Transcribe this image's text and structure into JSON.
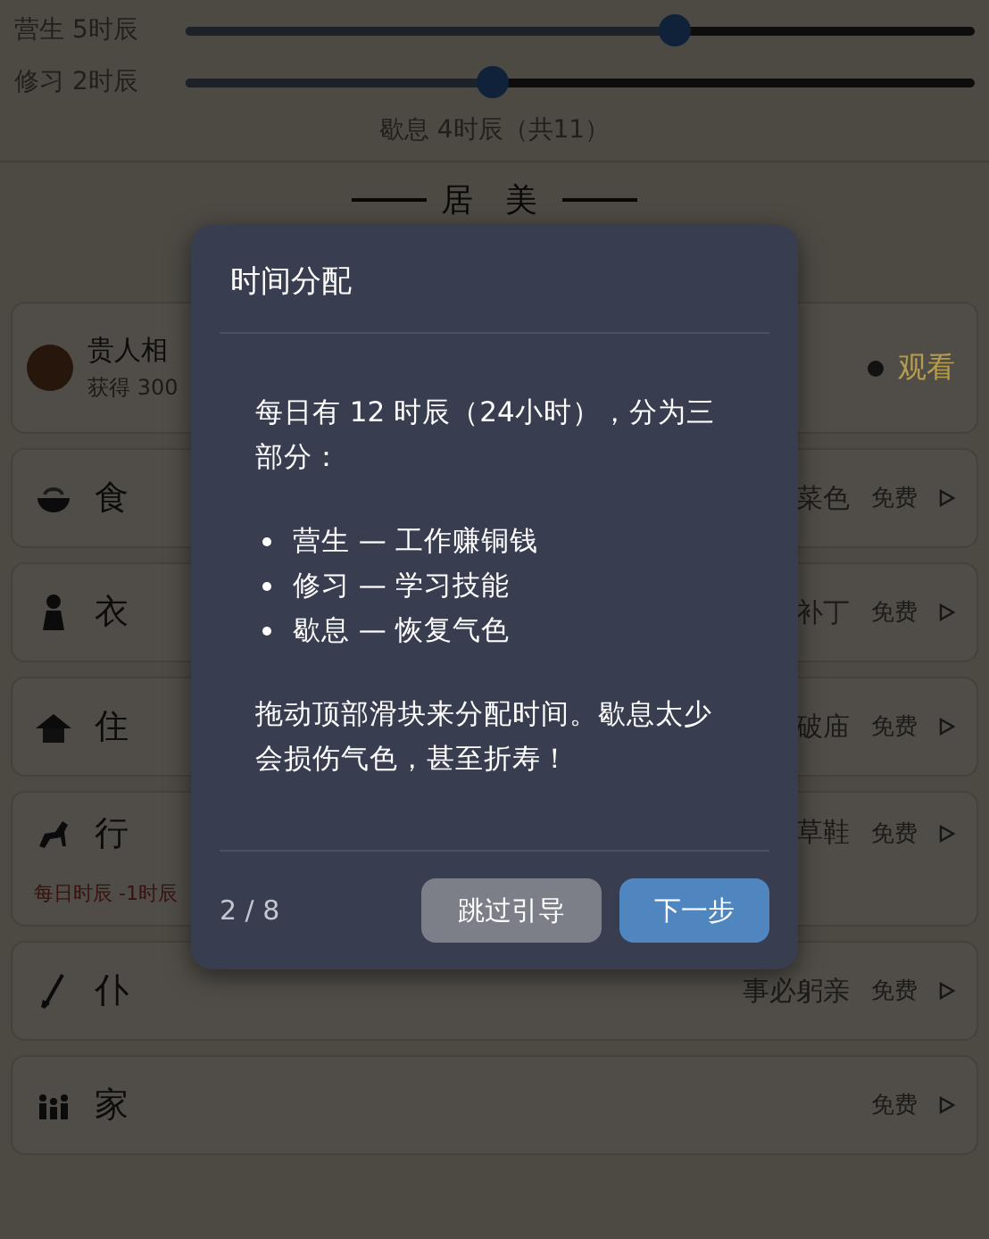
{
  "sliders": [
    {
      "label": "营生 5时辰",
      "level": 0.62
    },
    {
      "label": "修习 2时辰",
      "level": 0.39
    }
  ],
  "rest_summary": "歇息 4时辰（共11）",
  "section_title": "居 美",
  "cards": [
    {
      "kind": "event",
      "title": "贵人相",
      "subtitle": "获得 300",
      "action": "观看"
    },
    {
      "kind": "item",
      "name": "食",
      "detail": "菜色",
      "price": "免费"
    },
    {
      "kind": "item",
      "name": "衣",
      "detail": "补丁",
      "price": "免费"
    },
    {
      "kind": "item",
      "name": "住",
      "detail": "破庙",
      "price": "免费"
    },
    {
      "kind": "item",
      "name": "行",
      "detail": "草鞋",
      "price": "免费",
      "note": "每日时辰 -1时辰"
    },
    {
      "kind": "item",
      "name": "仆",
      "detail": "事必躬亲",
      "price": "免费"
    },
    {
      "kind": "item",
      "name": "家",
      "price": "免费"
    }
  ],
  "dialog": {
    "title": "时间分配",
    "intro": "每日有 12 时辰（24小时），分为三部分：",
    "bullets": [
      "营生 — 工作赚铜钱",
      "修习 — 学习技能",
      "歇息 — 恢复气色"
    ],
    "note": "拖动顶部滑块来分配时间。歇息太少会损伤气色，甚至折寿！",
    "step": "2 / 8",
    "buttons": [
      {
        "label": "跳过引导",
        "kind": "secondary"
      },
      {
        "label": "下一步",
        "kind": "primary"
      }
    ]
  }
}
